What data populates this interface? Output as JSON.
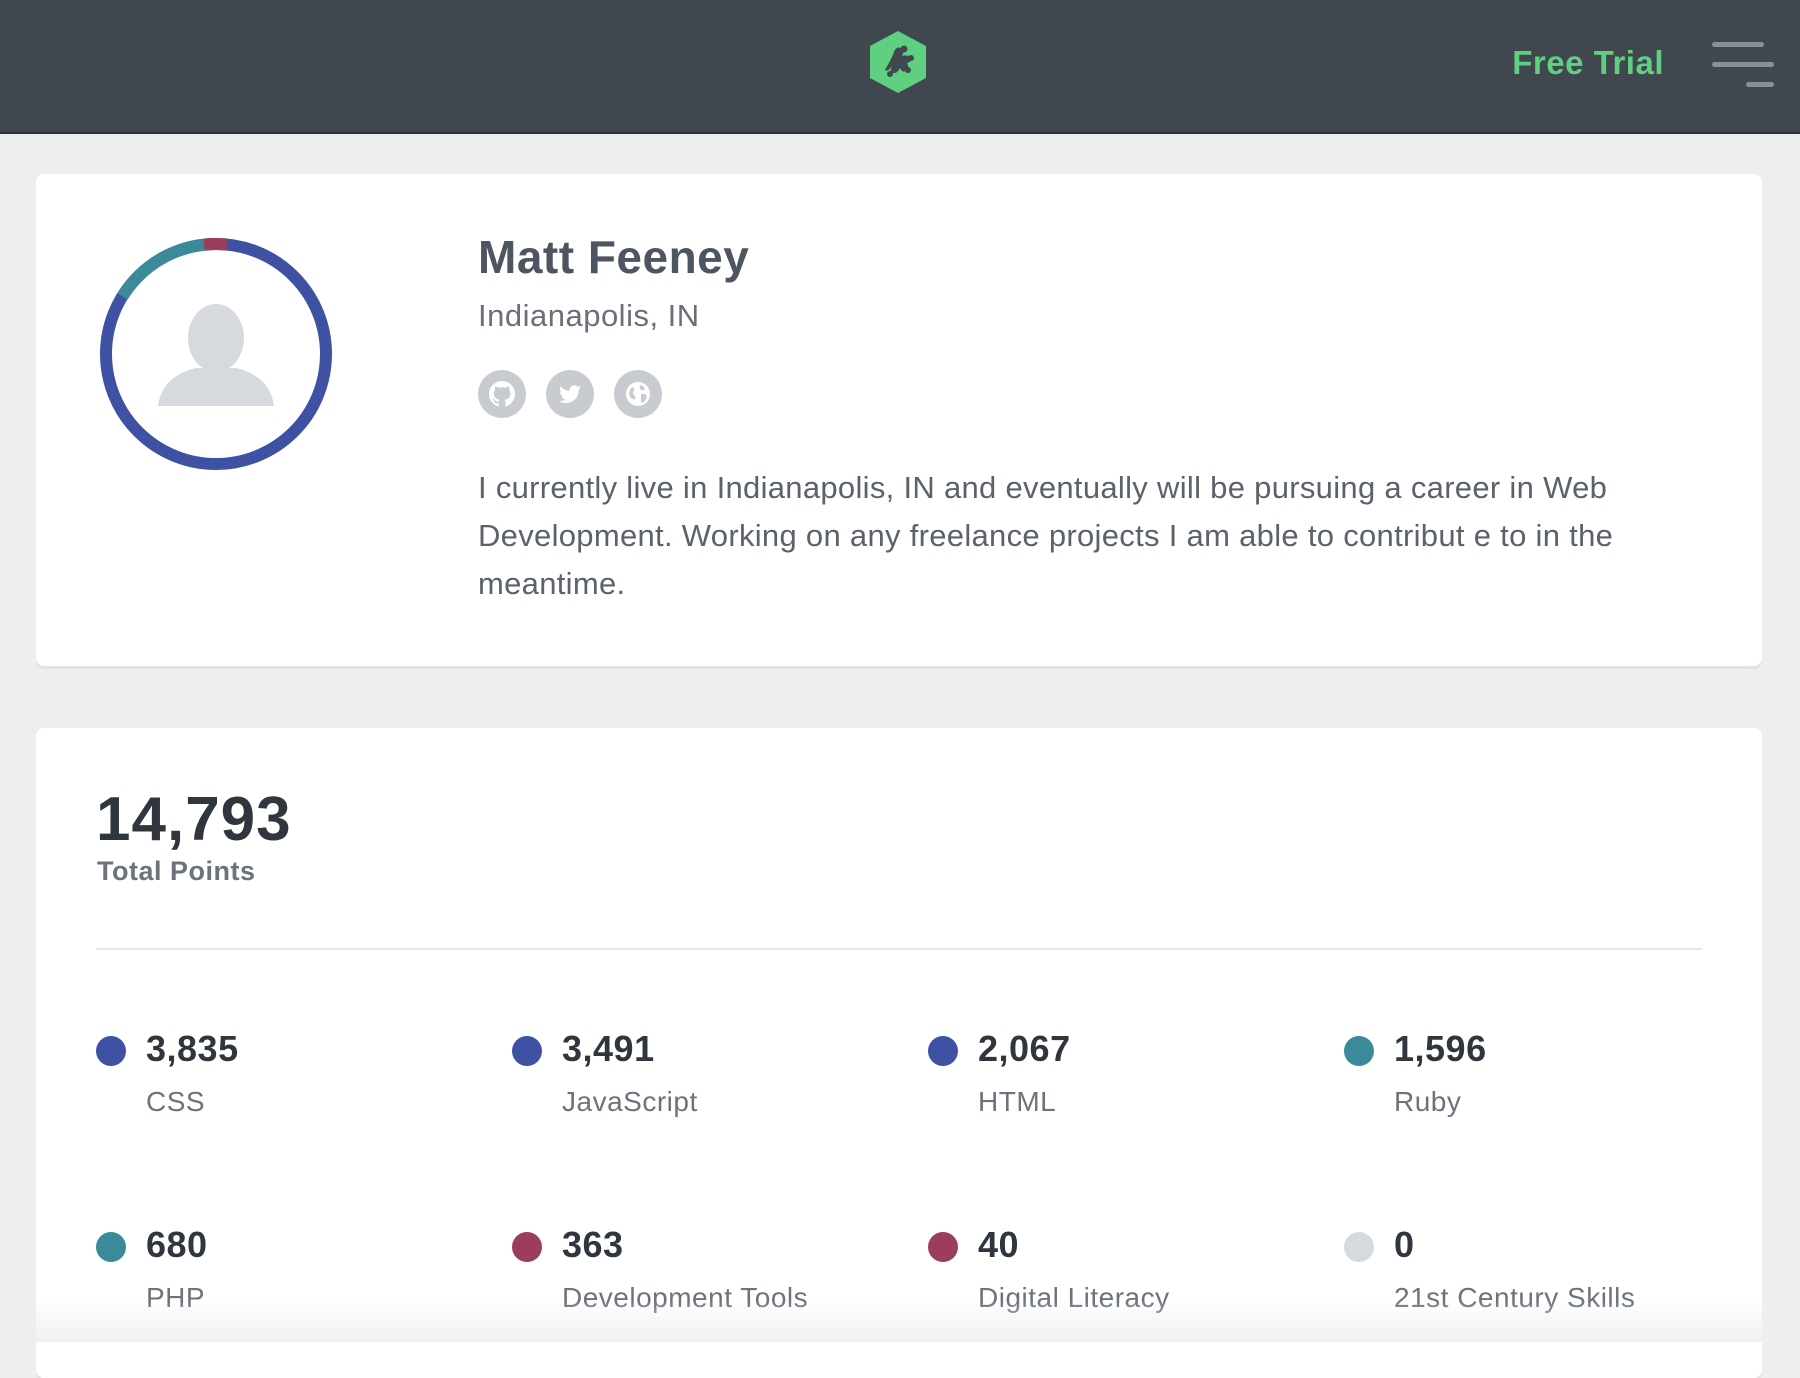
{
  "header": {
    "logo_icon": "treehouse-frog-logo-icon",
    "free_trial_label": "Free Trial",
    "menu_icon": "hamburger-menu-icon",
    "brand_color": "#5fcf80"
  },
  "profile": {
    "name": "Matt Feeney",
    "location": "Indianapolis, IN",
    "avatar_icon": "default-user-avatar-icon",
    "socials": [
      "github-icon",
      "twitter-icon",
      "globe-icon"
    ],
    "bio": "I currently live in Indianapolis, IN and eventually will be pursuing a career in Web Development. Working on any freelance projects I am able to contribut e to in the meantime."
  },
  "points": {
    "total": "14,793",
    "total_label": "Total Points",
    "topics": [
      {
        "value": "3,835",
        "label": "CSS",
        "color": "#3f51a3"
      },
      {
        "value": "3,491",
        "label": "JavaScript",
        "color": "#3f51a3"
      },
      {
        "value": "2,067",
        "label": "HTML",
        "color": "#3f51a3"
      },
      {
        "value": "1,596",
        "label": "Ruby",
        "color": "#3a8a99"
      },
      {
        "value": "680",
        "label": "PHP",
        "color": "#3a8a99"
      },
      {
        "value": "363",
        "label": "Development Tools",
        "color": "#9a3e5c"
      },
      {
        "value": "40",
        "label": "Digital Literacy",
        "color": "#9a3e5c"
      },
      {
        "value": "0",
        "label": "21st Century Skills",
        "color": "#d6d9de"
      }
    ]
  }
}
